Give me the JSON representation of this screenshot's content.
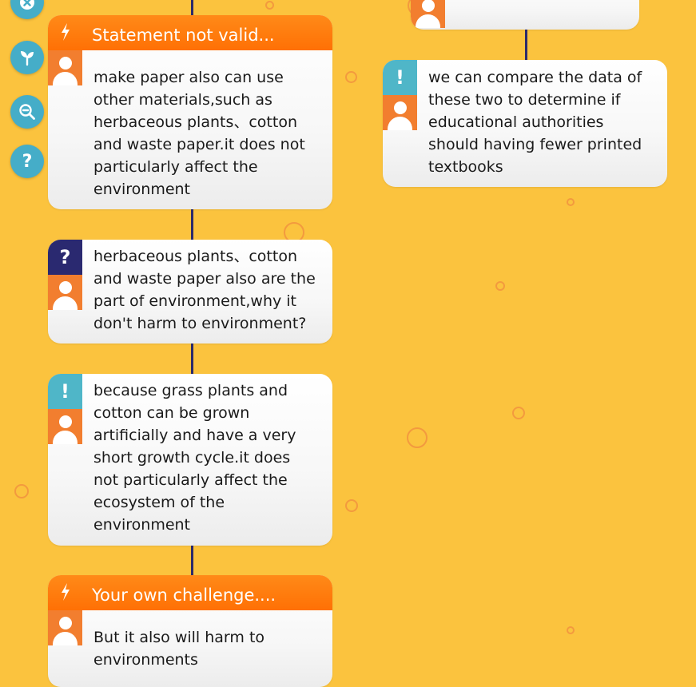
{
  "sidebar": {
    "buttons": [
      {
        "name": "close",
        "icon": "close-icon"
      },
      {
        "name": "sprout",
        "icon": "sprout-icon"
      },
      {
        "name": "zoom-out",
        "icon": "zoom-out-icon"
      },
      {
        "name": "help",
        "icon": "help-icon",
        "glyph": "?"
      }
    ]
  },
  "cards": {
    "statement": {
      "header": "Statement not valid...",
      "text": "make paper also can use other materials,such as herbaceous plants、cotton and waste paper.it does not particularly affect the environment"
    },
    "question": {
      "type_glyph": "?",
      "text": "herbaceous plants、cotton and waste paper also are the part of environment,why it don't harm to environment?"
    },
    "answer": {
      "type_glyph": "!",
      "text": "because grass plants and cotton can be grown artificially and have a very short growth cycle.it does not particularly affect the ecosystem of the environment"
    },
    "challenge": {
      "header": "Your own challenge....",
      "text": "But it also will harm to environments"
    },
    "right_answer": {
      "type_glyph": "!",
      "text": "we can compare the data of these two to determine if educational authorities should having fewer printed textbooks"
    }
  },
  "colors": {
    "background": "#fbc33e",
    "header_orange": "#ff7a0f",
    "avatar_orange": "#f27e2f",
    "question_navy": "#2a2970",
    "exclaim_teal": "#4fb6c8",
    "sidebar_teal": "#45adc8",
    "connector": "#2c2a6b"
  }
}
